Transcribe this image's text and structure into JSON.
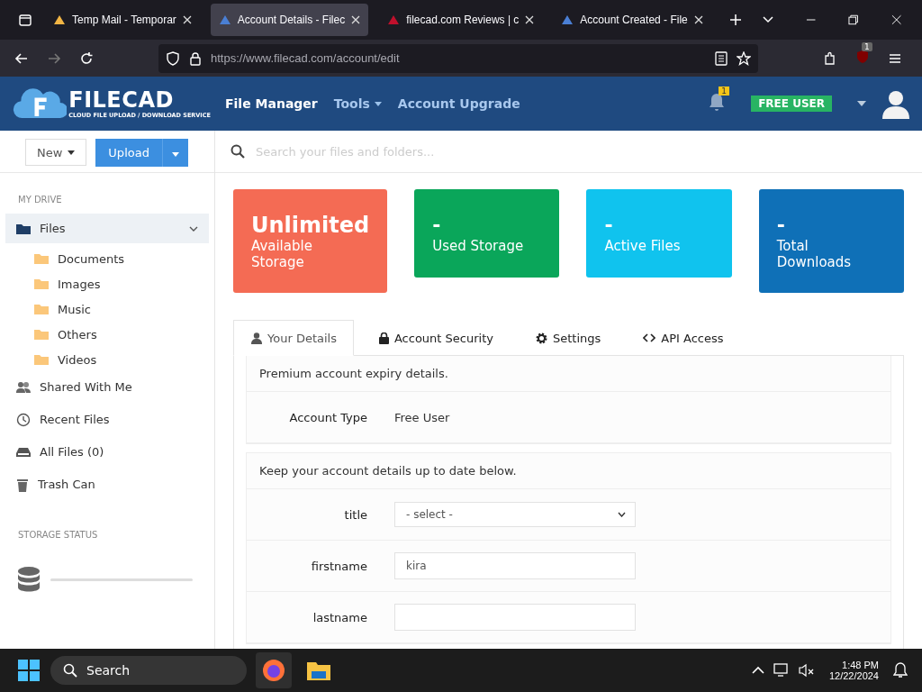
{
  "browser": {
    "tabs": [
      {
        "title": "Temp Mail - Temporar",
        "selected": false,
        "color": "#f2b544"
      },
      {
        "title": "Account Details - Filec",
        "selected": true,
        "color": "#4a7fd4"
      },
      {
        "title": "filecad.com Reviews | c",
        "selected": false,
        "color": "#c0102c"
      },
      {
        "title": "Account Created - File",
        "selected": false,
        "color": "#4a7fd4"
      }
    ],
    "url_host": "https://www.filecad.com",
    "url_path": "/account/edit",
    "extension_badge": "1"
  },
  "header": {
    "logo": "FILECAD",
    "tagline": "CLOUD FILE UPLOAD / DOWNLOAD SERVICE",
    "nav": [
      {
        "label": "File Manager",
        "dropdown": false
      },
      {
        "label": "Tools",
        "dropdown": true
      },
      {
        "label": "Account Upgrade",
        "dropdown": false
      }
    ],
    "notifications": "1",
    "plan": "FREE USER"
  },
  "toolbar": {
    "new": "New",
    "upload": "Upload",
    "search_placeholder": "Search your files and folders..."
  },
  "sidebar": {
    "heading": "MY DRIVE",
    "items": [
      {
        "label": "Files",
        "kind": "files",
        "selected": true,
        "expanded": true,
        "children": [
          {
            "label": "Documents"
          },
          {
            "label": "Images"
          },
          {
            "label": "Music"
          },
          {
            "label": "Others"
          },
          {
            "label": "Videos"
          }
        ]
      },
      {
        "label": "Shared With Me",
        "kind": "shared",
        "selected": false
      },
      {
        "label": "Recent Files",
        "kind": "recent",
        "selected": false
      },
      {
        "label": "All Files (0)",
        "kind": "all",
        "selected": false
      },
      {
        "label": "Trash Can",
        "kind": "trash",
        "selected": false
      }
    ],
    "storage_heading": "STORAGE STATUS"
  },
  "stats": [
    {
      "value": "Unlimited",
      "label": "Available Storage",
      "color": "#f46b54"
    },
    {
      "value": "-",
      "label": "Used Storage",
      "color": "#0aa65a"
    },
    {
      "value": "-",
      "label": "Active Files",
      "color": "#10c3ee"
    },
    {
      "value": "-",
      "label": "Total Downloads",
      "color": "#0f70b7"
    }
  ],
  "tabs": [
    {
      "label": "Your Details",
      "selected": true
    },
    {
      "label": "Account Security",
      "selected": false
    },
    {
      "label": "Settings",
      "selected": false
    },
    {
      "label": "API Access",
      "selected": false
    }
  ],
  "expiry": {
    "heading": "Premium account expiry details.",
    "rows": [
      {
        "label": "Account Type",
        "value": "Free User"
      }
    ]
  },
  "details": {
    "heading": "Keep your account details up to date below.",
    "fields": [
      {
        "label": "title",
        "kind": "select",
        "value": "- select -"
      },
      {
        "label": "firstname",
        "kind": "text",
        "value": "kira"
      },
      {
        "label": "lastname",
        "kind": "text"
      }
    ]
  },
  "taskbar": {
    "search": "Search",
    "time": "1:48 PM",
    "date": "12/22/2024"
  }
}
